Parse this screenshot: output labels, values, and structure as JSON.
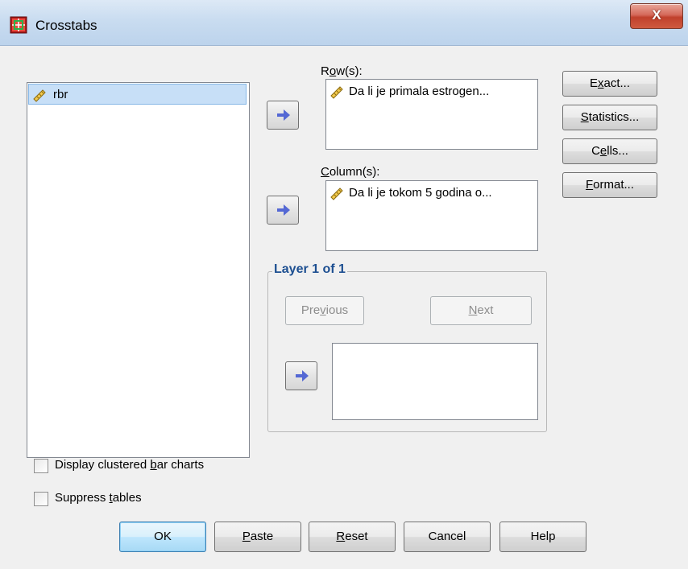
{
  "window": {
    "title": "Crosstabs",
    "close_glyph": "X"
  },
  "variables": {
    "items": [
      {
        "label": "rbr",
        "icon": "ruler-icon"
      }
    ]
  },
  "rows": {
    "label_pre": "R",
    "label_u": "o",
    "label_post": "w(s):",
    "items": [
      {
        "label": "Da li je primala estrogen...",
        "icon": "ruler-icon"
      }
    ]
  },
  "columns": {
    "label_pre": "",
    "label_u": "C",
    "label_post": "olumn(s):",
    "items": [
      {
        "label": "Da li je tokom 5 godina o...",
        "icon": "ruler-icon"
      }
    ]
  },
  "layer": {
    "title": "Layer 1 of 1",
    "previous": {
      "pre": "Pre",
      "u": "v",
      "post": "ious"
    },
    "next": {
      "pre": "",
      "u": "N",
      "post": "ext"
    }
  },
  "side_buttons": [
    {
      "pre": "E",
      "u": "x",
      "post": "act..."
    },
    {
      "pre": "",
      "u": "S",
      "post": "tatistics..."
    },
    {
      "pre": "C",
      "u": "e",
      "post": "lls..."
    },
    {
      "pre": "",
      "u": "F",
      "post": "ormat..."
    }
  ],
  "options": {
    "clustered": {
      "pre": "Display clustered ",
      "u": "b",
      "post": "ar charts",
      "checked": false
    },
    "suppress": {
      "pre": "Suppress ",
      "u": "t",
      "post": "ables",
      "checked": false
    }
  },
  "bottom_buttons": {
    "ok": {
      "pre": "OK",
      "u": "",
      "post": ""
    },
    "paste": {
      "pre": "",
      "u": "P",
      "post": "aste"
    },
    "reset": {
      "pre": "",
      "u": "R",
      "post": "eset"
    },
    "cancel": {
      "pre": "Cancel",
      "u": "",
      "post": ""
    },
    "help": {
      "pre": "Help",
      "u": "",
      "post": ""
    }
  },
  "colors": {
    "layer_title": "#1d4f91",
    "selection": "#c7dff7",
    "arrow": "#5468d4"
  }
}
